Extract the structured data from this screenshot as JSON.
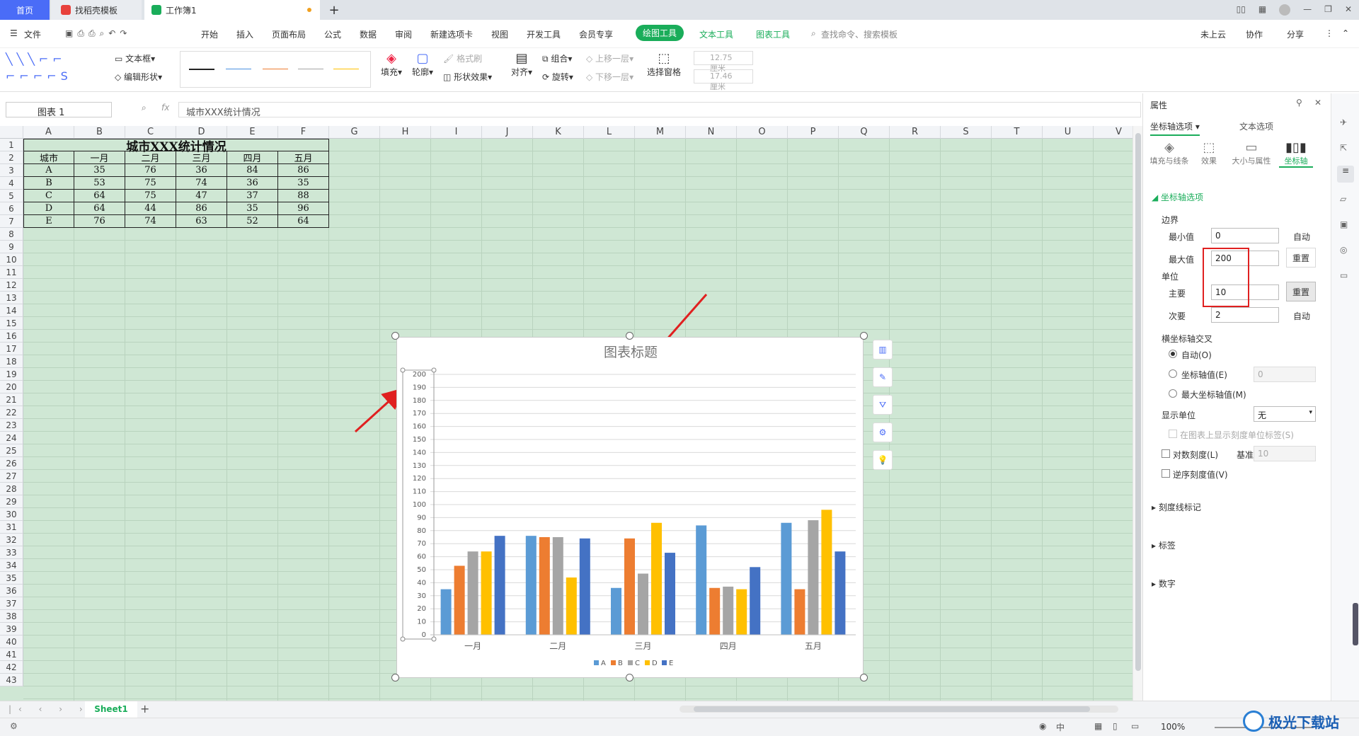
{
  "tabs": {
    "home": "首页",
    "template": "找稻壳模板",
    "workbook": "工作簿1"
  },
  "menu": [
    "文件",
    "开始",
    "插入",
    "页面布局",
    "公式",
    "数据",
    "审阅",
    "新建选项卡",
    "视图",
    "开发工具",
    "会员专享",
    "绘图工具",
    "文本工具",
    "图表工具"
  ],
  "search_placeholder": "查找命令、搜索模板",
  "header_right": {
    "cloud": "未上云",
    "collab": "协作",
    "share": "分享"
  },
  "ribbon": {
    "textbox": "文本框",
    "edit_shape": "编辑形状",
    "fill": "填充",
    "outline": "轮廓",
    "format_painter": "格式刷",
    "shape_effects": "形状效果",
    "align": "对齐",
    "group": "组合",
    "rotate": "旋转",
    "bring_forward": "上移一层",
    "send_backward": "下移一层",
    "selection_pane": "选择窗格",
    "height": "12.75厘米",
    "width": "17.46厘米"
  },
  "namebox": "图表 1",
  "formula": "城市XXX统计情况",
  "columns": [
    "A",
    "B",
    "C",
    "D",
    "E",
    "F",
    "G",
    "H",
    "I",
    "J",
    "K",
    "L",
    "M",
    "N",
    "O",
    "P",
    "Q",
    "R",
    "S",
    "T",
    "U",
    "V"
  ],
  "rows": [
    "1",
    "2",
    "3",
    "4",
    "5",
    "6",
    "7",
    "8",
    "9",
    "10",
    "11",
    "12",
    "13",
    "14",
    "15",
    "16",
    "17",
    "18",
    "19",
    "20",
    "21",
    "22",
    "23",
    "24",
    "25",
    "26",
    "27",
    "28",
    "29",
    "30",
    "31",
    "32",
    "33",
    "34",
    "35",
    "36",
    "37",
    "38",
    "39",
    "40",
    "41",
    "42",
    "43"
  ],
  "table": {
    "title": "城市XXX统计情况",
    "headers": [
      "城市",
      "一月",
      "二月",
      "三月",
      "四月",
      "五月"
    ],
    "rows": [
      [
        "A",
        "35",
        "76",
        "36",
        "84",
        "86"
      ],
      [
        "B",
        "53",
        "75",
        "74",
        "36",
        "35"
      ],
      [
        "C",
        "64",
        "75",
        "47",
        "37",
        "88"
      ],
      [
        "D",
        "64",
        "44",
        "86",
        "35",
        "96"
      ],
      [
        "E",
        "76",
        "74",
        "63",
        "52",
        "64"
      ]
    ]
  },
  "chart_data": {
    "type": "bar",
    "title": "图表标题",
    "categories": [
      "一月",
      "二月",
      "三月",
      "四月",
      "五月"
    ],
    "series": [
      {
        "name": "A",
        "color": "#5b9bd5",
        "values": [
          35,
          76,
          36,
          84,
          86
        ]
      },
      {
        "name": "B",
        "color": "#ed7d31",
        "values": [
          53,
          75,
          74,
          36,
          35
        ]
      },
      {
        "name": "C",
        "color": "#a5a5a5",
        "values": [
          64,
          75,
          47,
          37,
          88
        ]
      },
      {
        "name": "D",
        "color": "#ffc000",
        "values": [
          64,
          44,
          86,
          35,
          96
        ]
      },
      {
        "name": "E",
        "color": "#4472c4",
        "values": [
          76,
          74,
          63,
          52,
          64
        ]
      }
    ],
    "ylim": [
      0,
      200
    ],
    "ytick_step": 10,
    "yticks": [
      "0",
      "10",
      "20",
      "30",
      "40",
      "50",
      "60",
      "70",
      "80",
      "90",
      "100",
      "110",
      "120",
      "130",
      "140",
      "150",
      "160",
      "170",
      "180",
      "190",
      "200"
    ],
    "legend": "bottom",
    "grid": true
  },
  "panel": {
    "title": "属性",
    "tab_axis": "坐标轴选项",
    "tab_text": "文本选项",
    "icons": [
      "填充与线条",
      "效果",
      "大小与属性",
      "坐标轴"
    ],
    "section": "坐标轴选项",
    "bounds": "边界",
    "min_label": "最小值",
    "min_value": "0",
    "max_label": "最大值",
    "max_value": "200",
    "auto": "自动",
    "reset": "重置",
    "units": "单位",
    "major_label": "主要",
    "major_value": "10",
    "minor_label": "次要",
    "minor_value": "2",
    "cross": "横坐标轴交叉",
    "cross_auto": "自动(O)",
    "cross_value": "坐标轴值(E)",
    "cross_value_input": "0",
    "cross_max": "最大坐标轴值(M)",
    "display_unit": "显示单位",
    "display_unit_value": "无",
    "show_unit_label": "在图表上显示刻度单位标签(S)",
    "log_scale": "对数刻度(L)",
    "base": "基准",
    "base_value": "10",
    "reverse": "逆序刻度值(V)",
    "tick_marks": "刻度线标记",
    "labels": "标签",
    "number": "数字"
  },
  "sheet_tab": "Sheet1",
  "zoom": "100%",
  "watermark": "极光下载站"
}
